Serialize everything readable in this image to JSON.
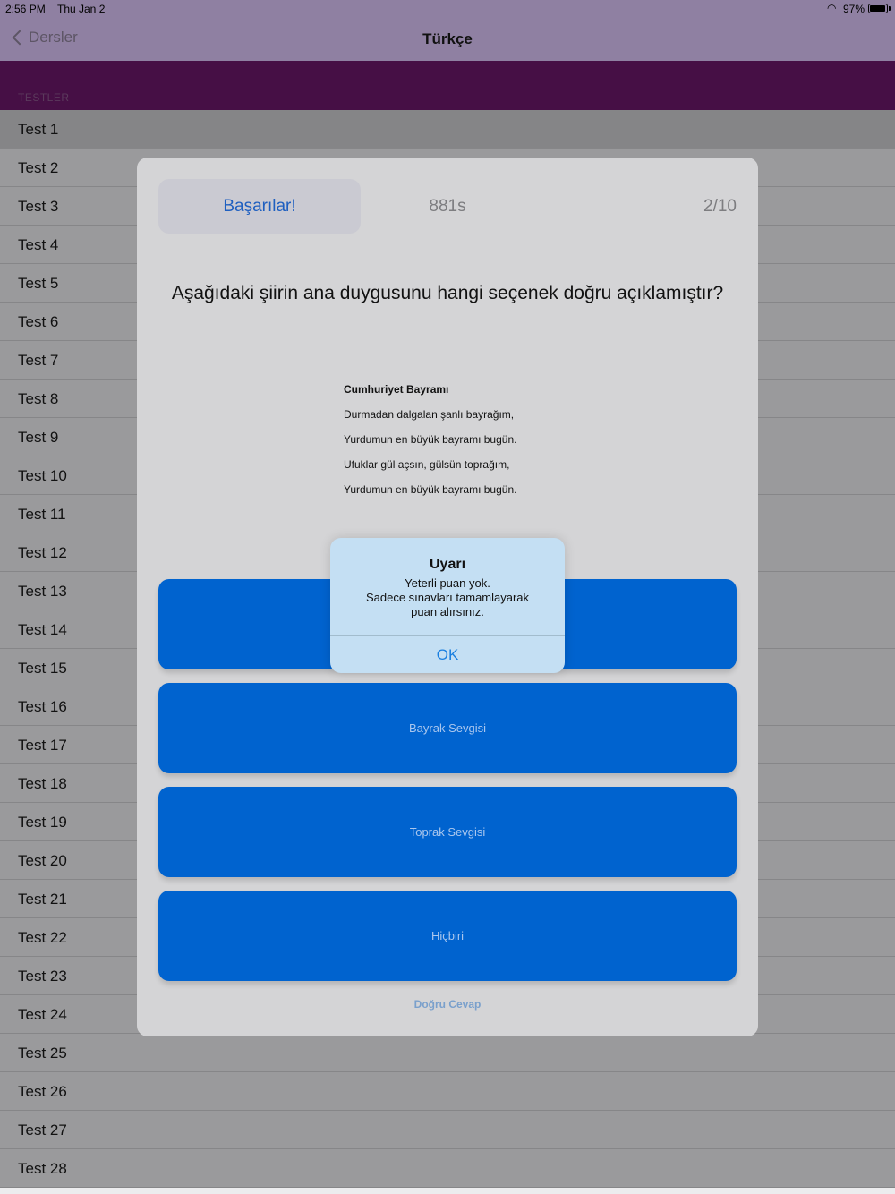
{
  "status": {
    "time": "2:56 PM",
    "date": "Thu Jan 2",
    "battery": "97%"
  },
  "nav": {
    "back_label": "Dersler",
    "title": "Türkçe"
  },
  "section_header": "TESTLER",
  "tests": [
    "Test 1",
    "Test 2",
    "Test 3",
    "Test 4",
    "Test 5",
    "Test 6",
    "Test 7",
    "Test 8",
    "Test 9",
    "Test 10",
    "Test 11",
    "Test 12",
    "Test 13",
    "Test 14",
    "Test 15",
    "Test 16",
    "Test 17",
    "Test 18",
    "Test 19",
    "Test 20",
    "Test 21",
    "Test 22",
    "Test 23",
    "Test 24",
    "Test 25",
    "Test 26",
    "Test 27",
    "Test 28"
  ],
  "quiz": {
    "motivation": "Başarılar!",
    "timer": "881s",
    "progress": "2/10",
    "question": "Aşağıdaki şiirin ana duygusunu hangi seçenek doğru açıklamıştır?",
    "poem": {
      "title": "Cumhuriyet Bayramı",
      "lines": [
        "Durmadan dalgalan şanlı bayrağım,",
        "Yurdumun en büyük bayramı bugün.",
        "Ufuklar gül açsın, gülsün toprağım,",
        "Yurdumun en büyük bayramı bugün."
      ]
    },
    "answers": [
      "",
      "Bayrak Sevgisi",
      "Toprak Sevgisi",
      "Hiçbiri"
    ],
    "correct_answer_link": "Doğru Cevap"
  },
  "alert": {
    "title": "Uyarı",
    "message_lines": [
      "Yeterli puan yok.",
      "Sadece sınavları tamamlayarak",
      "puan alırsınız."
    ],
    "ok_label": "OK"
  }
}
